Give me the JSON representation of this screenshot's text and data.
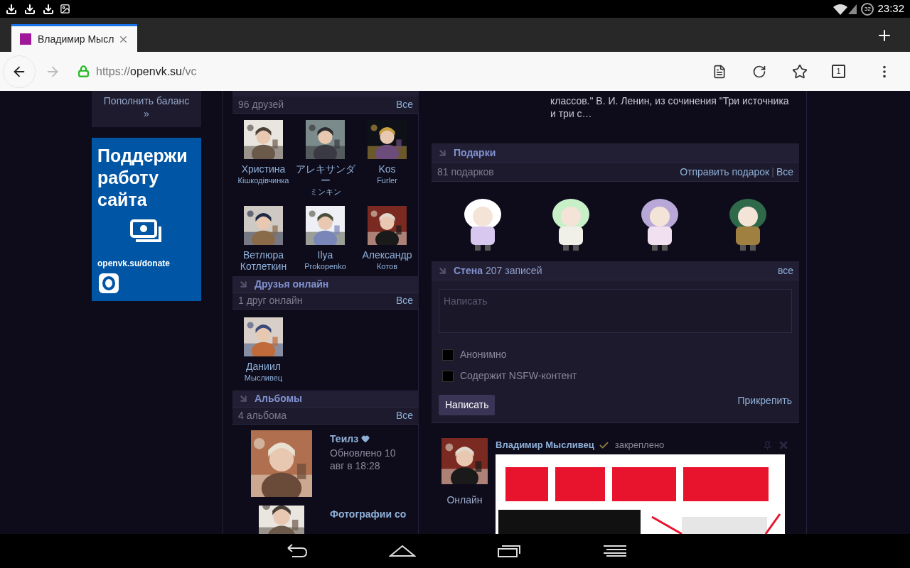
{
  "status_bar": {
    "battery": "32",
    "time": "23:32"
  },
  "browser": {
    "tab": {
      "title": "Владимир Мысл",
      "selected": true
    },
    "url": {
      "scheme": "https://",
      "host": "openvk.su",
      "path": "/vc"
    },
    "tabs_count": "1"
  },
  "sidebar": {
    "balance_link": "Пополнить баланс »",
    "donate_banner": {
      "title": "Поддержи работу сайта",
      "url": "openvk.su/donate"
    }
  },
  "friends": {
    "count_text": "96 друзей",
    "all_link": "Все",
    "items": [
      {
        "name": "Христина",
        "subname": "Кішкодівчинка"
      },
      {
        "name": "アレキサンダー",
        "subname": "ミンキン"
      },
      {
        "name": "Kos",
        "subname": "Furler"
      },
      {
        "name": "Ветлюра Котлеткин"
      },
      {
        "name": "Ilya",
        "subname": "Prokopenko"
      },
      {
        "name": "Александр",
        "subname": "Котов"
      }
    ]
  },
  "online_friends": {
    "title": "Друзья онлайн",
    "count_text": "1 друг онлайн",
    "all_link": "Все",
    "items": [
      {
        "name": "Даниил",
        "subname": "Мысливец"
      }
    ]
  },
  "albums": {
    "title": "Альбомы",
    "count_text": "4 альбома",
    "all_link": "Все",
    "items": [
      {
        "title": "Теилз",
        "favorite": true,
        "updated": "Обновлено 10 авг в 18:28"
      },
      {
        "title": "Фотографии со",
        "favorite": false
      }
    ]
  },
  "profile_quote": "классов.\" В. И. Ленин, из сочинения \"Три источника и три с…",
  "gifts": {
    "title": "Подарки",
    "count_text": "81 подарков",
    "send_link": "Отправить подарок",
    "separator": "|",
    "all_link": "Все"
  },
  "wall": {
    "title": "Стена",
    "count_text": "207 записей",
    "all_link": "все",
    "placeholder": "Написать",
    "options": [
      {
        "label": "Анонимно",
        "checked": false
      },
      {
        "label": "Содержит NSFW-контент",
        "checked": false
      }
    ],
    "submit": "Написать",
    "attach": "Прикрепить"
  },
  "post": {
    "author": "Владимир Мысливец",
    "verified": true,
    "pinned_label": "закреплено",
    "author_status": "Онлайн"
  }
}
